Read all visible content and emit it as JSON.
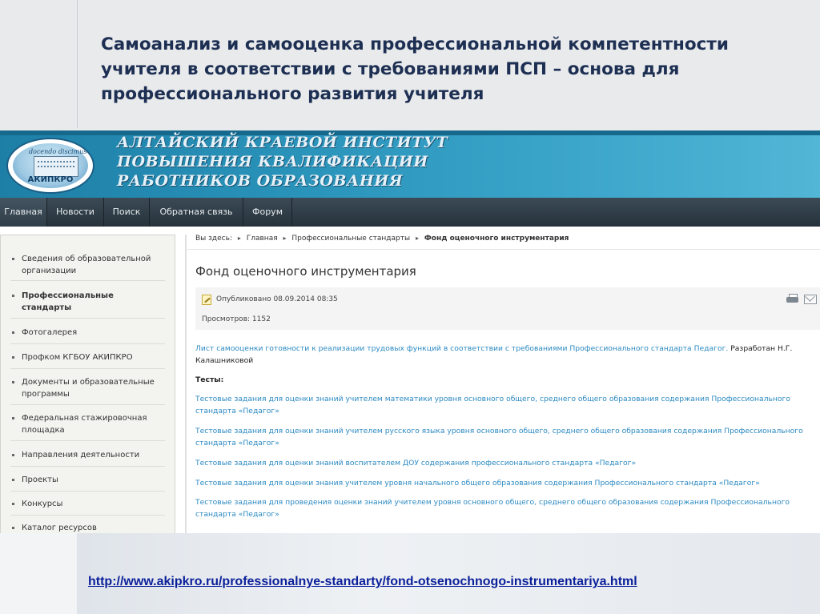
{
  "slide": {
    "title_lines": [
      "Самоанализ и самооценка профессиональной компетентности",
      "учителя в соответствии с требованиями ПСП – основа для",
      "профессионального развития учителя"
    ],
    "url": "http://www.akipkro.ru/professionalnye-standarty/fond-otsenochnogo-instrumentariya.html"
  },
  "site": {
    "logo": {
      "abbr": "АКИПКРО",
      "script_text": "docendo discimus"
    },
    "name_lines": [
      "АЛТАЙСКИЙ КРАЕВОЙ ИНСТИТУТ",
      "ПОВЫШЕНИЯ КВАЛИФИКАЦИИ",
      "РАБОТНИКОВ ОБРАЗОВАНИЯ"
    ],
    "colors": {
      "banner": "#2b95bc",
      "navbar": "#2f3d47",
      "link": "#2c8ac2"
    }
  },
  "nav": [
    "Главная",
    "Новости",
    "Поиск",
    "Обратная связь",
    "Форум"
  ],
  "sidebar": {
    "items": [
      {
        "label": "Сведения об образовательной организации"
      },
      {
        "label": "Профессиональные стандарты"
      },
      {
        "label": "Фотогалерея"
      },
      {
        "label": "Профком КГБОУ АКИПКРО"
      },
      {
        "label": "Документы и образовательные программы"
      },
      {
        "label": "Федеральная стажировочная площадка"
      },
      {
        "label": "Направления деятельности"
      },
      {
        "label": "Проекты"
      },
      {
        "label": "Конкурсы"
      },
      {
        "label": "Каталог ресурсов"
      }
    ]
  },
  "breadcrumb": {
    "prefix": "Вы здесь:",
    "items": [
      "Главная",
      "Профессиональные стандарты",
      "Фонд оценочного инструментария"
    ]
  },
  "article": {
    "title": "Фонд оценочного инструментария",
    "published": "Опубликовано 08.09.2014 08:35",
    "views": "Просмотров: 1152",
    "intro_link": "Лист самооценки готовности к реализации трудовых функций в соответствии с требованиями Профессионального стандарта Педагог.",
    "intro_author": " Разработан Н.Г. Калашниковой",
    "tests_heading": "Тесты:",
    "tests": [
      "Тестовые задания для оценки знаний учителем математики уровня основного общего, среднего общего образования содержания Профессионального стандарта «Педагог»",
      "Тестовые задания для оценки знаний учителем русского языка уровня основного общего, среднего общего образования содержания Профессионального стандарта «Педагог»",
      "Тестовые задания для оценки знаний воспитателем ДОУ содержания профессионального стандарта «Педагог»",
      "Тестовые задания для оценки знания учителем уровня начального общего образования содержания Профессионального стандарта «Педагог»",
      "Тестовые задания для проведения оценки знаний учителем уровня основного общего, среднего общего образования содержания Профессионального стандарта «Педагог»"
    ]
  }
}
